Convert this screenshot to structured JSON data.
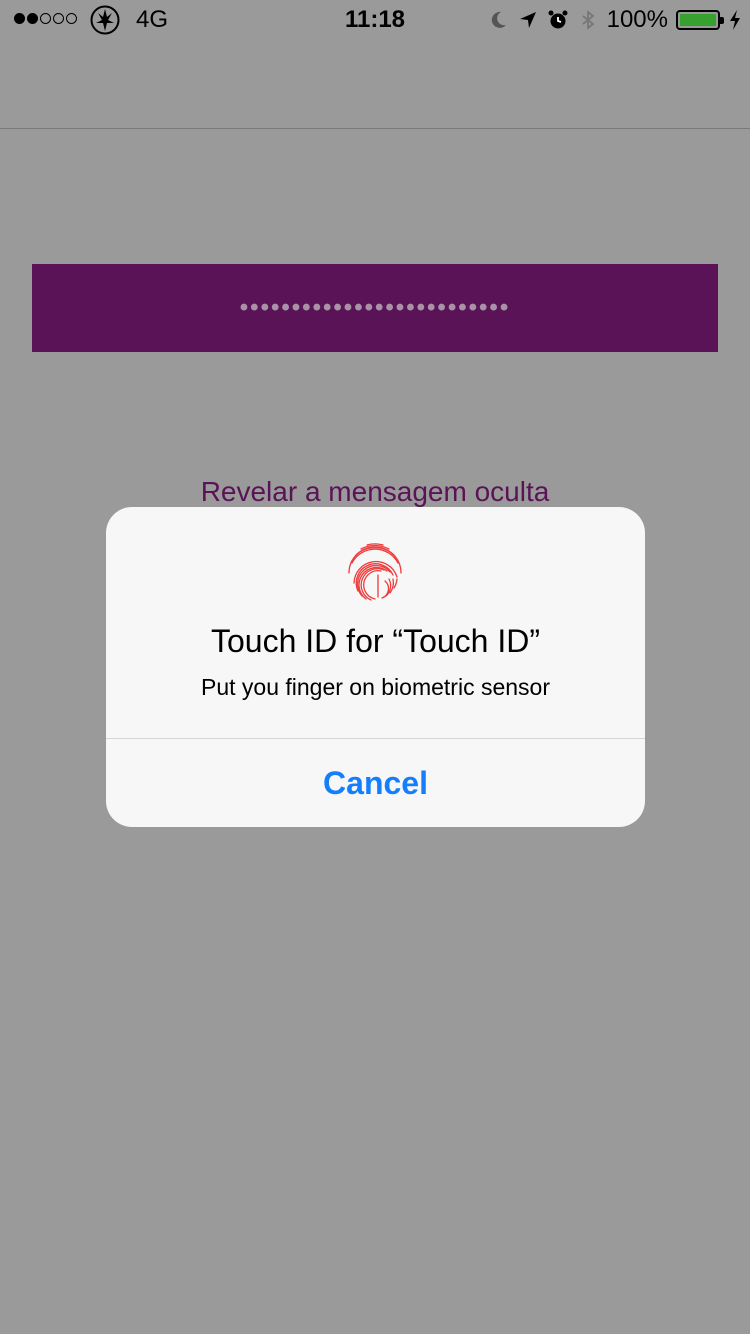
{
  "status_bar": {
    "signal_filled": 2,
    "signal_total": 5,
    "network": "4G",
    "time": "11:18",
    "battery_percent": "100%",
    "battery_level": 1.0,
    "icons": [
      "moon-icon",
      "location-arrow-icon",
      "alarm-icon",
      "bluetooth-icon",
      "charging-bolt-icon"
    ]
  },
  "screen": {
    "hidden_message_dots": "••••••••••••••••••••••••••",
    "reveal_label": "Revelar a mensagem oculta",
    "accent_color": "#5a1357"
  },
  "alert": {
    "title": "Touch ID for “Touch ID”",
    "message": "Put you finger on biometric sensor",
    "cancel_label": "Cancel",
    "icon": "fingerprint-icon",
    "button_color": "#147efb"
  }
}
